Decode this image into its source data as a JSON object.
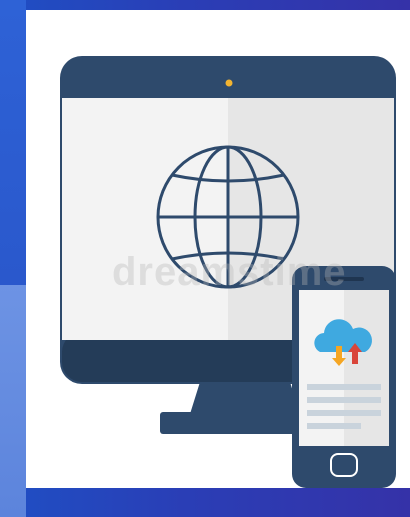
{
  "illustration": {
    "watermark_text": "dreamstime",
    "colors": {
      "background_blue": "#2a3eb6",
      "device_navy": "#2e4a6c",
      "device_dark": "#243c58",
      "screen_light": "#f3f3f3",
      "screen_shade": "#e6e6e6",
      "cloud_blue": "#3fa9e0",
      "arrow_orange": "#f5a623",
      "arrow_red": "#d9453a",
      "text_lines": "#c9d3dc",
      "camera_dot": "#f2b431"
    },
    "icons": [
      "desktop-monitor-icon",
      "globe-icon",
      "smartphone-icon",
      "cloud-sync-icon"
    ]
  }
}
